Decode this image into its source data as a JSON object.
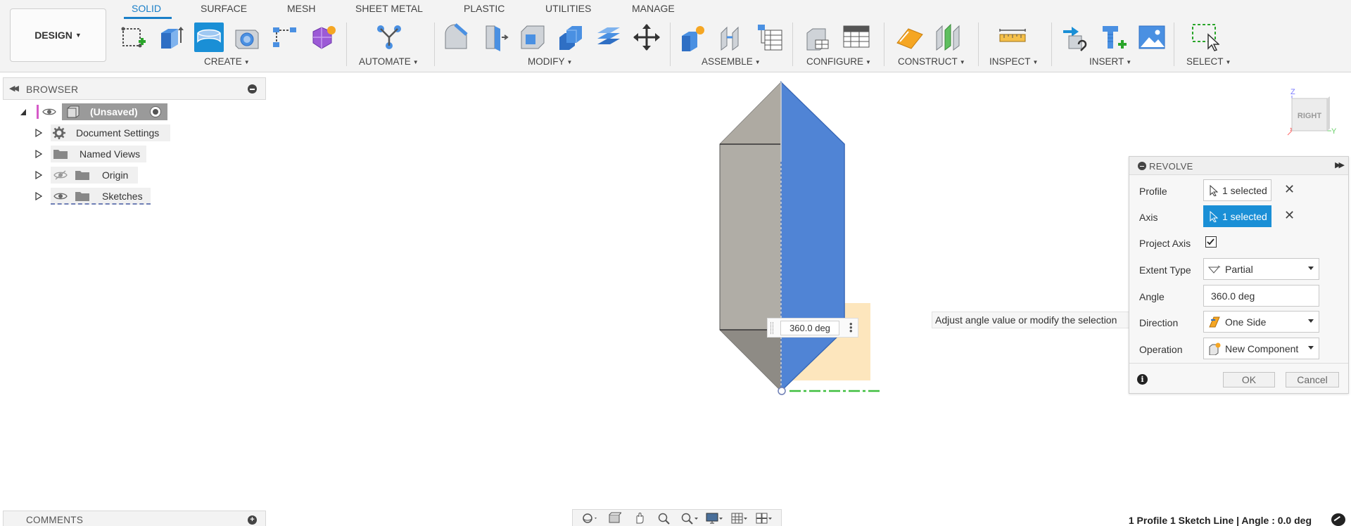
{
  "toolbar": {
    "workspace_label": "DESIGN",
    "tabs": [
      {
        "label": "SOLID",
        "active": true
      },
      {
        "label": "SURFACE",
        "active": false
      },
      {
        "label": "MESH",
        "active": false
      },
      {
        "label": "SHEET METAL",
        "active": false
      },
      {
        "label": "PLASTIC",
        "active": false
      },
      {
        "label": "UTILITIES",
        "active": false
      },
      {
        "label": "MANAGE",
        "active": false
      }
    ],
    "groups": {
      "create": "CREATE",
      "automate": "AUTOMATE",
      "modify": "MODIFY",
      "assemble": "ASSEMBLE",
      "configure": "CONFIGURE",
      "construct": "CONSTRUCT",
      "inspect": "INSPECT",
      "insert": "INSERT",
      "select": "SELECT"
    },
    "accent_color": "#1a7fc8"
  },
  "browser": {
    "title": "BROWSER",
    "items": [
      {
        "label": "(Unsaved)",
        "icon": "component-icon"
      },
      {
        "label": "Document Settings",
        "icon": "gear-icon"
      },
      {
        "label": "Named Views",
        "icon": "folder-icon"
      },
      {
        "label": "Origin",
        "icon": "folder-icon"
      },
      {
        "label": "Sketches",
        "icon": "folder-icon"
      }
    ]
  },
  "canvas": {
    "angle_value": "360.0 deg",
    "tooltip": "Adjust angle value or modify the selection",
    "viewcube_face": "RIGHT",
    "axis_z": "Z",
    "axis_y": "Y",
    "profile_color": "#4a7fd0",
    "body_color": "#b0ada6",
    "sketch_plane_color": "#fde3b6"
  },
  "revolve": {
    "title": "REVOLVE",
    "profile_label": "Profile",
    "profile_value": "1 selected",
    "axis_label": "Axis",
    "axis_value": "1 selected",
    "project_axis_label": "Project Axis",
    "project_axis_checked": true,
    "extent_type_label": "Extent Type",
    "extent_type_value": "Partial",
    "angle_label": "Angle",
    "angle_value": "360.0 deg",
    "direction_label": "Direction",
    "direction_value": "One Side",
    "operation_label": "Operation",
    "operation_value": "New Component",
    "ok_label": "OK",
    "cancel_label": "Cancel"
  },
  "comments": {
    "title": "COMMENTS"
  },
  "status": {
    "text": "1 Profile 1 Sketch Line | Angle : 0.0 deg"
  }
}
